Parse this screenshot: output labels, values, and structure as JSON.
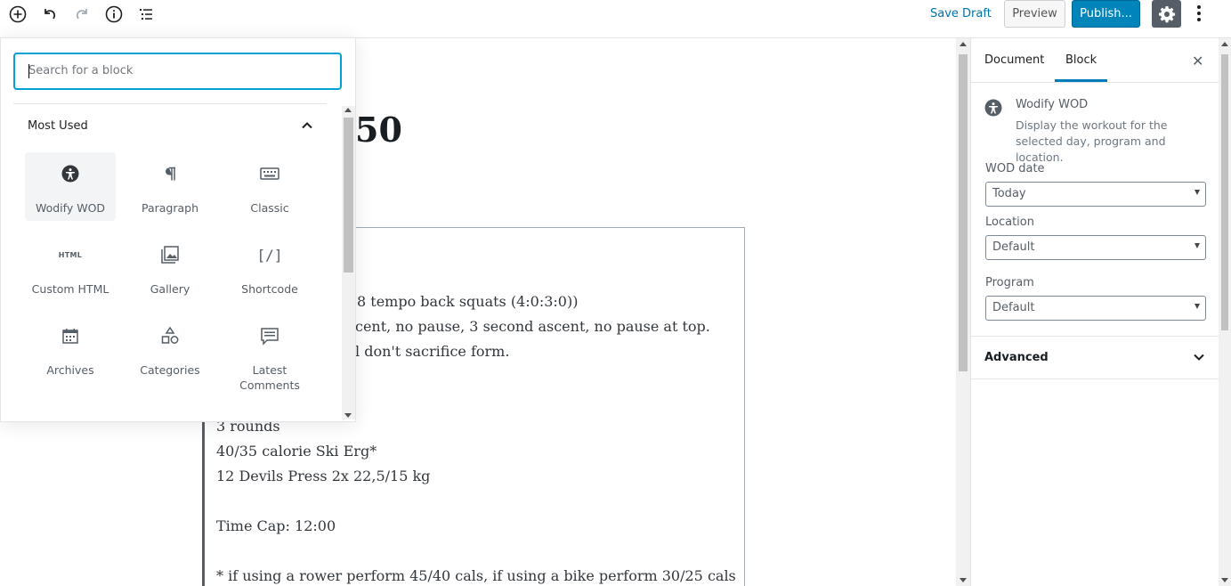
{
  "toolbar": {
    "save_draft": "Save Draft",
    "preview": "Preview",
    "publish": "Publish...",
    "icons": [
      "add-block-icon",
      "undo-icon",
      "redo-icon",
      "info-icon",
      "outline-icon",
      "gear-icon",
      "more-vertical-icon"
    ]
  },
  "inserter": {
    "search_placeholder": "Search for a block",
    "panel_title": "Most Used",
    "blocks": [
      {
        "label": "Wodify WOD",
        "icon": "person-icon"
      },
      {
        "label": "Paragraph",
        "icon": "pilcrow-icon"
      },
      {
        "label": "Classic",
        "icon": "keyboard-icon"
      },
      {
        "label": "Custom HTML",
        "icon": "html-icon"
      },
      {
        "label": "Gallery",
        "icon": "gallery-icon"
      },
      {
        "label": "Shortcode",
        "icon": "shortcode-icon"
      },
      {
        "label": "Archives",
        "icon": "calendar-icon"
      },
      {
        "label": "Categories",
        "icon": "shapes-icon"
      },
      {
        "label": "Latest Comments",
        "icon": "comment-icon"
      }
    ],
    "html_icon_text": "HTML",
    "shortcode_icon_text": "[/]"
  },
  "post": {
    "title_visible": "50",
    "lines": [
      "8 tempo back squats (4:0:3:0))",
      "cent, no pause, 3 second ascent, no pause at top.",
      "l don't sacrifice form.",
      "3 rounds",
      "40/35 calorie Ski Erg*",
      "12 Devils Press 2x 22,5/15 kg",
      "Time Cap: 12:00",
      "* if using a rower perform 45/40 cals, if using a bike perform 30/25 cals"
    ]
  },
  "sidebar": {
    "tab_document": "Document",
    "tab_block": "Block",
    "close": "✕",
    "block_title": "Wodify WOD",
    "block_description": "Display the workout for the selected day, program and location.",
    "wod_date_label": "WOD date",
    "wod_date_value": "Today",
    "location_label": "Location",
    "location_value": "Default",
    "program_label": "Program",
    "program_value": "Default",
    "advanced_label": "Advanced"
  },
  "colors": {
    "accent": "#0085ba",
    "link": "#0073aa",
    "focus": "#00a0d2",
    "tab_active": "#007cba"
  }
}
